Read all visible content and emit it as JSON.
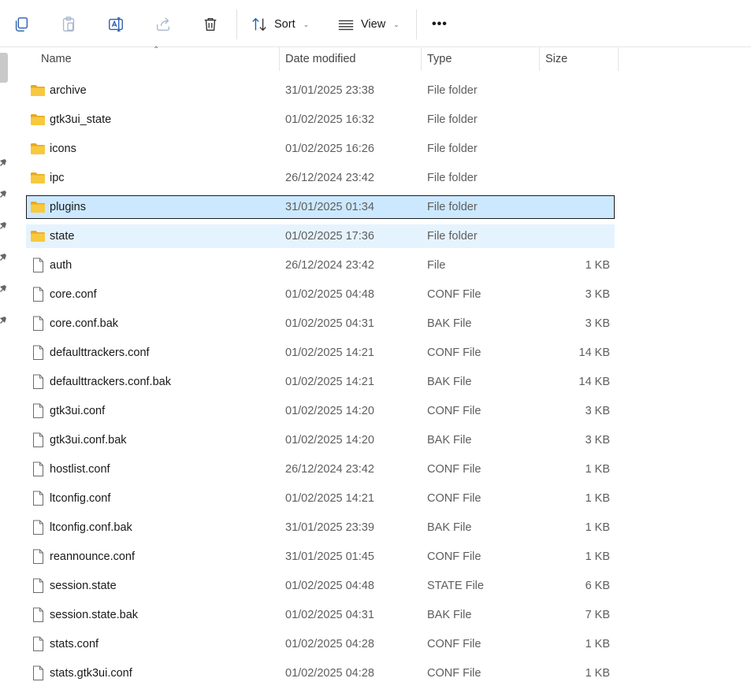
{
  "toolbar": {
    "sort_label": "Sort",
    "view_label": "View",
    "more_label": "•••"
  },
  "columns": {
    "name": "Name",
    "date_modified": "Date modified",
    "type": "Type",
    "size": "Size"
  },
  "files": [
    {
      "name": "archive",
      "date": "31/01/2025 23:38",
      "type": "File folder",
      "size": "",
      "kind": "folder"
    },
    {
      "name": "gtk3ui_state",
      "date": "01/02/2025 16:32",
      "type": "File folder",
      "size": "",
      "kind": "folder"
    },
    {
      "name": "icons",
      "date": "01/02/2025 16:26",
      "type": "File folder",
      "size": "",
      "kind": "folder"
    },
    {
      "name": "ipc",
      "date": "26/12/2024 23:42",
      "type": "File folder",
      "size": "",
      "kind": "folder"
    },
    {
      "name": "plugins",
      "date": "31/01/2025 01:34",
      "type": "File folder",
      "size": "",
      "kind": "folder"
    },
    {
      "name": "state",
      "date": "01/02/2025 17:36",
      "type": "File folder",
      "size": "",
      "kind": "folder"
    },
    {
      "name": "auth",
      "date": "26/12/2024 23:42",
      "type": "File",
      "size": "1 KB",
      "kind": "file"
    },
    {
      "name": "core.conf",
      "date": "01/02/2025 04:48",
      "type": "CONF File",
      "size": "3 KB",
      "kind": "file"
    },
    {
      "name": "core.conf.bak",
      "date": "01/02/2025 04:31",
      "type": "BAK File",
      "size": "3 KB",
      "kind": "file"
    },
    {
      "name": "defaulttrackers.conf",
      "date": "01/02/2025 14:21",
      "type": "CONF File",
      "size": "14 KB",
      "kind": "file"
    },
    {
      "name": "defaulttrackers.conf.bak",
      "date": "01/02/2025 14:21",
      "type": "BAK File",
      "size": "14 KB",
      "kind": "file"
    },
    {
      "name": "gtk3ui.conf",
      "date": "01/02/2025 14:20",
      "type": "CONF File",
      "size": "3 KB",
      "kind": "file"
    },
    {
      "name": "gtk3ui.conf.bak",
      "date": "01/02/2025 14:20",
      "type": "BAK File",
      "size": "3 KB",
      "kind": "file"
    },
    {
      "name": "hostlist.conf",
      "date": "26/12/2024 23:42",
      "type": "CONF File",
      "size": "1 KB",
      "kind": "file"
    },
    {
      "name": "ltconfig.conf",
      "date": "01/02/2025 14:21",
      "type": "CONF File",
      "size": "1 KB",
      "kind": "file"
    },
    {
      "name": "ltconfig.conf.bak",
      "date": "31/01/2025 23:39",
      "type": "BAK File",
      "size": "1 KB",
      "kind": "file"
    },
    {
      "name": "reannounce.conf",
      "date": "31/01/2025 01:45",
      "type": "CONF File",
      "size": "1 KB",
      "kind": "file"
    },
    {
      "name": "session.state",
      "date": "01/02/2025 04:48",
      "type": "STATE File",
      "size": "6 KB",
      "kind": "file"
    },
    {
      "name": "session.state.bak",
      "date": "01/02/2025 04:31",
      "type": "BAK File",
      "size": "7 KB",
      "kind": "file"
    },
    {
      "name": "stats.conf",
      "date": "01/02/2025 04:28",
      "type": "CONF File",
      "size": "1 KB",
      "kind": "file"
    },
    {
      "name": "stats.gtk3ui.conf",
      "date": "01/02/2025 04:28",
      "type": "CONF File",
      "size": "1 KB",
      "kind": "file"
    }
  ],
  "selected_index": 4,
  "hover_index": 5,
  "colors": {
    "selection_bg": "#cce8ff",
    "hover_bg": "#e5f3ff",
    "folder_yellow": "#f8c93e",
    "accent": "#1a5fb4"
  }
}
